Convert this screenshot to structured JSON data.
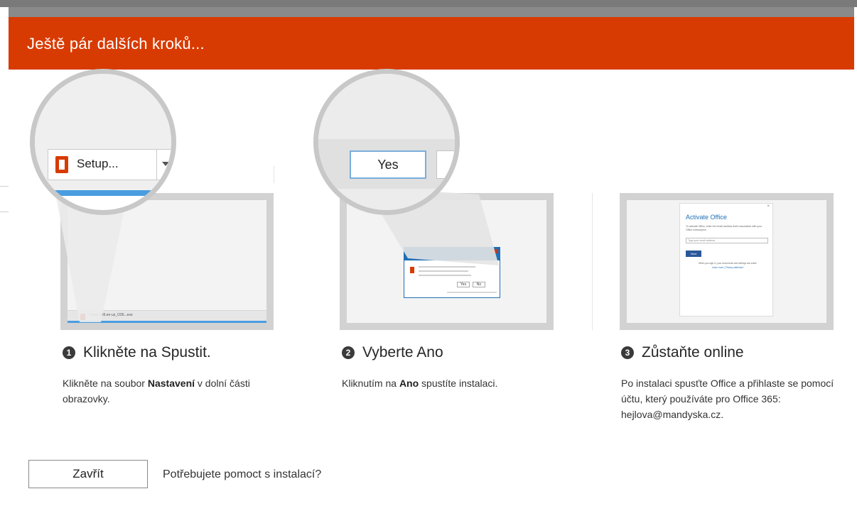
{
  "dialog": {
    "title": "Ještě pár dalších kroků...",
    "close_label": "Zavřít",
    "help_link": "Potřebujete pomoct s instalací?"
  },
  "step1": {
    "number": "1",
    "heading": "Klikněte na Spustit.",
    "desc_pre": "Klikněte na soubor ",
    "desc_bold": "Nastavení",
    "desc_post": " v dolní části obrazovky.",
    "mag_button": "Setup...",
    "taskbar_file": "Setup.X86.en-us_O36...exe"
  },
  "step2": {
    "number": "2",
    "heading": "Vyberte Ano",
    "desc_pre": "Kliknutím na ",
    "desc_bold": "Ano",
    "desc_post": " spustíte instalaci.",
    "mag_button": "Yes",
    "uac_yes": "Yes",
    "uac_no": "No"
  },
  "step3": {
    "number": "3",
    "heading": "Zůstaňte online",
    "desc": "Po instalaci spusťte Office a přihlaste se pomocí účtu, který používáte pro Office 365: hejlova@mandyska.cz.",
    "activate_title": "Activate Office",
    "activate_text": "To activate Office, enter the email address that's associated with your Office subscription.",
    "activate_placeholder": "Type your email address",
    "activate_next": "Next",
    "activate_footer": "When you sign in, your documents and settings are online",
    "activate_links": "Learn more  |  Privacy statement"
  },
  "colors": {
    "brand": "#d83b01",
    "uac_blue": "#1f6fb5",
    "taskbar_blue": "#4a9de0"
  }
}
